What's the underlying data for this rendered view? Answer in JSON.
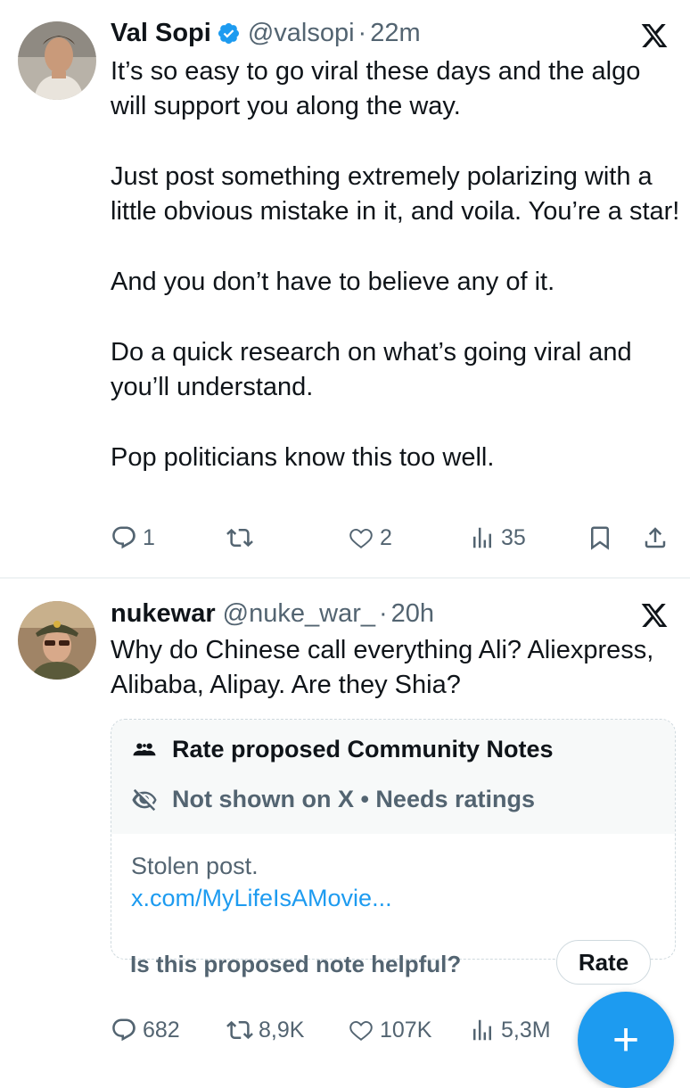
{
  "tweets": [
    {
      "name": "Val Sopi",
      "handle": "@valsopi",
      "dot": "·",
      "time": "22m",
      "paragraphs": [
        "It’s so easy to go viral these days and the algo will support you along the way.",
        "Just post something extremely polarizing with a little obvious mistake in it, and voila. You’re a star!",
        "And you don’t have to believe any of it.",
        "Do a quick research on what’s going viral and you’ll understand.",
        "Pop politicians know this too well."
      ],
      "actions": {
        "replies": "1",
        "reposts": "",
        "likes": "2",
        "views": "35"
      }
    },
    {
      "name": "nukewar",
      "handle": "@nuke_war_",
      "dot": "·",
      "time": "20h",
      "paragraphs": [
        "Why do Chinese call everything Ali? Aliexpress, Alibaba, Alipay. Are they Shia?"
      ],
      "community_note": {
        "title": "Rate proposed Community Notes",
        "status": "Not shown on X • Needs ratings",
        "text": "Stolen post.",
        "link": "x.com/MyLifeIsAMovie...",
        "question": "Is this proposed note helpful?",
        "rate_label": "Rate"
      },
      "actions": {
        "replies": "682",
        "reposts": "8,9K",
        "likes": "107K",
        "views": "5,3M"
      }
    }
  ],
  "fab_label": "+",
  "colors": {
    "accent": "#1d9bf0",
    "text": "#0f1419",
    "muted": "#536471",
    "border": "#cfd9de"
  }
}
